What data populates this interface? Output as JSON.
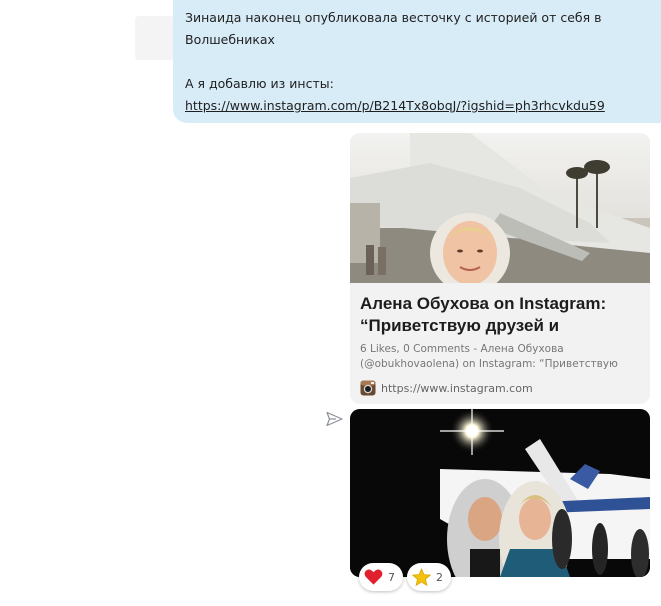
{
  "message": {
    "line1": "Зинаида наконец опубликовала весточку с историей от себя в",
    "line2": "Волшебниках",
    "line3": "А я добавлю из инсты:",
    "link": "https://www.instagram.com/p/B214Tx8obqJ/?igshid=ph3rhcvkdu59"
  },
  "link_preview": {
    "title": "Алена Обухова on Instagram: “Приветствую друзей и",
    "description": "6 Likes, 0 Comments - Алена Обухова (@obukhovaolena) on Instagram: “Приветствую",
    "source": "https://www.instagram.com"
  },
  "reactions": [
    {
      "icon": "heart-icon",
      "count": "7"
    },
    {
      "icon": "star-icon",
      "count": "2"
    }
  ],
  "colors": {
    "bubble": "#d8ecf8",
    "card": "#f2f2f2",
    "heart": "#e0202c",
    "star": "#f4c20d"
  }
}
